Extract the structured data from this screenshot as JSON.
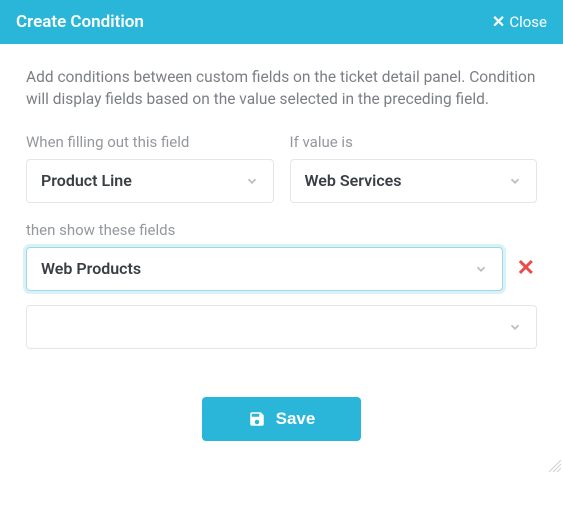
{
  "header": {
    "title": "Create Condition",
    "close_label": "Close"
  },
  "description": "Add conditions between custom fields on the ticket detail panel. Condition will display fields based on the value selected in the preceding field.",
  "field_select": {
    "label": "When filling out this field",
    "value": "Product Line"
  },
  "value_select": {
    "label": "If value is",
    "value": "Web Services"
  },
  "show_fields": {
    "label": "then show these fields",
    "rows": [
      {
        "value": "Web Products",
        "removable": true,
        "focused": true
      },
      {
        "value": "",
        "removable": false,
        "focused": false
      }
    ]
  },
  "save_label": "Save"
}
